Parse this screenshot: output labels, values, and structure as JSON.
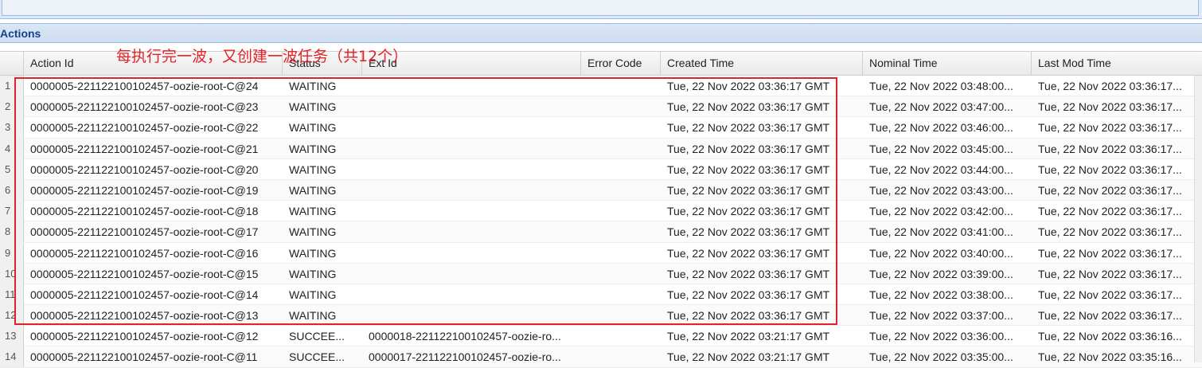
{
  "panel": {
    "title": "Actions"
  },
  "annotation": {
    "text": "每执行完一波，又创建一波任务（共12个）"
  },
  "columns": {
    "action_id": "Action Id",
    "status": "Status",
    "ext_id": "Ext Id",
    "error_code": "Error Code",
    "created_time": "Created Time",
    "nominal_time": "Nominal Time",
    "last_mod_time": "Last Mod Time"
  },
  "rows": [
    {
      "num": "1",
      "action_id": "0000005-221122100102457-oozie-root-C@24",
      "status": "WAITING",
      "ext_id": "",
      "error_code": "",
      "created_time": "Tue, 22 Nov 2022 03:36:17 GMT",
      "nominal_time": "Tue, 22 Nov 2022 03:48:00...",
      "last_mod_time": "Tue, 22 Nov 2022 03:36:17..."
    },
    {
      "num": "2",
      "action_id": "0000005-221122100102457-oozie-root-C@23",
      "status": "WAITING",
      "ext_id": "",
      "error_code": "",
      "created_time": "Tue, 22 Nov 2022 03:36:17 GMT",
      "nominal_time": "Tue, 22 Nov 2022 03:47:00...",
      "last_mod_time": "Tue, 22 Nov 2022 03:36:17..."
    },
    {
      "num": "3",
      "action_id": "0000005-221122100102457-oozie-root-C@22",
      "status": "WAITING",
      "ext_id": "",
      "error_code": "",
      "created_time": "Tue, 22 Nov 2022 03:36:17 GMT",
      "nominal_time": "Tue, 22 Nov 2022 03:46:00...",
      "last_mod_time": "Tue, 22 Nov 2022 03:36:17..."
    },
    {
      "num": "4",
      "action_id": "0000005-221122100102457-oozie-root-C@21",
      "status": "WAITING",
      "ext_id": "",
      "error_code": "",
      "created_time": "Tue, 22 Nov 2022 03:36:17 GMT",
      "nominal_time": "Tue, 22 Nov 2022 03:45:00...",
      "last_mod_time": "Tue, 22 Nov 2022 03:36:17..."
    },
    {
      "num": "5",
      "action_id": "0000005-221122100102457-oozie-root-C@20",
      "status": "WAITING",
      "ext_id": "",
      "error_code": "",
      "created_time": "Tue, 22 Nov 2022 03:36:17 GMT",
      "nominal_time": "Tue, 22 Nov 2022 03:44:00...",
      "last_mod_time": "Tue, 22 Nov 2022 03:36:17..."
    },
    {
      "num": "6",
      "action_id": "0000005-221122100102457-oozie-root-C@19",
      "status": "WAITING",
      "ext_id": "",
      "error_code": "",
      "created_time": "Tue, 22 Nov 2022 03:36:17 GMT",
      "nominal_time": "Tue, 22 Nov 2022 03:43:00...",
      "last_mod_time": "Tue, 22 Nov 2022 03:36:17..."
    },
    {
      "num": "7",
      "action_id": "0000005-221122100102457-oozie-root-C@18",
      "status": "WAITING",
      "ext_id": "",
      "error_code": "",
      "created_time": "Tue, 22 Nov 2022 03:36:17 GMT",
      "nominal_time": "Tue, 22 Nov 2022 03:42:00...",
      "last_mod_time": "Tue, 22 Nov 2022 03:36:17..."
    },
    {
      "num": "8",
      "action_id": "0000005-221122100102457-oozie-root-C@17",
      "status": "WAITING",
      "ext_id": "",
      "error_code": "",
      "created_time": "Tue, 22 Nov 2022 03:36:17 GMT",
      "nominal_time": "Tue, 22 Nov 2022 03:41:00...",
      "last_mod_time": "Tue, 22 Nov 2022 03:36:17..."
    },
    {
      "num": "9",
      "action_id": "0000005-221122100102457-oozie-root-C@16",
      "status": "WAITING",
      "ext_id": "",
      "error_code": "",
      "created_time": "Tue, 22 Nov 2022 03:36:17 GMT",
      "nominal_time": "Tue, 22 Nov 2022 03:40:00...",
      "last_mod_time": "Tue, 22 Nov 2022 03:36:17..."
    },
    {
      "num": "10",
      "action_id": "0000005-221122100102457-oozie-root-C@15",
      "status": "WAITING",
      "ext_id": "",
      "error_code": "",
      "created_time": "Tue, 22 Nov 2022 03:36:17 GMT",
      "nominal_time": "Tue, 22 Nov 2022 03:39:00...",
      "last_mod_time": "Tue, 22 Nov 2022 03:36:17..."
    },
    {
      "num": "11",
      "action_id": "0000005-221122100102457-oozie-root-C@14",
      "status": "WAITING",
      "ext_id": "",
      "error_code": "",
      "created_time": "Tue, 22 Nov 2022 03:36:17 GMT",
      "nominal_time": "Tue, 22 Nov 2022 03:38:00...",
      "last_mod_time": "Tue, 22 Nov 2022 03:36:17..."
    },
    {
      "num": "12",
      "action_id": "0000005-221122100102457-oozie-root-C@13",
      "status": "WAITING",
      "ext_id": "",
      "error_code": "",
      "created_time": "Tue, 22 Nov 2022 03:36:17 GMT",
      "nominal_time": "Tue, 22 Nov 2022 03:37:00...",
      "last_mod_time": "Tue, 22 Nov 2022 03:36:17..."
    },
    {
      "num": "13",
      "action_id": "0000005-221122100102457-oozie-root-C@12",
      "status": "SUCCEE...",
      "ext_id": "0000018-221122100102457-oozie-ro...",
      "error_code": "",
      "created_time": "Tue, 22 Nov 2022 03:21:17 GMT",
      "nominal_time": "Tue, 22 Nov 2022 03:36:00...",
      "last_mod_time": "Tue, 22 Nov 2022 03:36:16..."
    },
    {
      "num": "14",
      "action_id": "0000005-221122100102457-oozie-root-C@11",
      "status": "SUCCEE...",
      "ext_id": "0000017-221122100102457-oozie-ro...",
      "error_code": "",
      "created_time": "Tue, 22 Nov 2022 03:21:17 GMT",
      "nominal_time": "Tue, 22 Nov 2022 03:35:00...",
      "last_mod_time": "Tue, 22 Nov 2022 03:35:16..."
    }
  ]
}
